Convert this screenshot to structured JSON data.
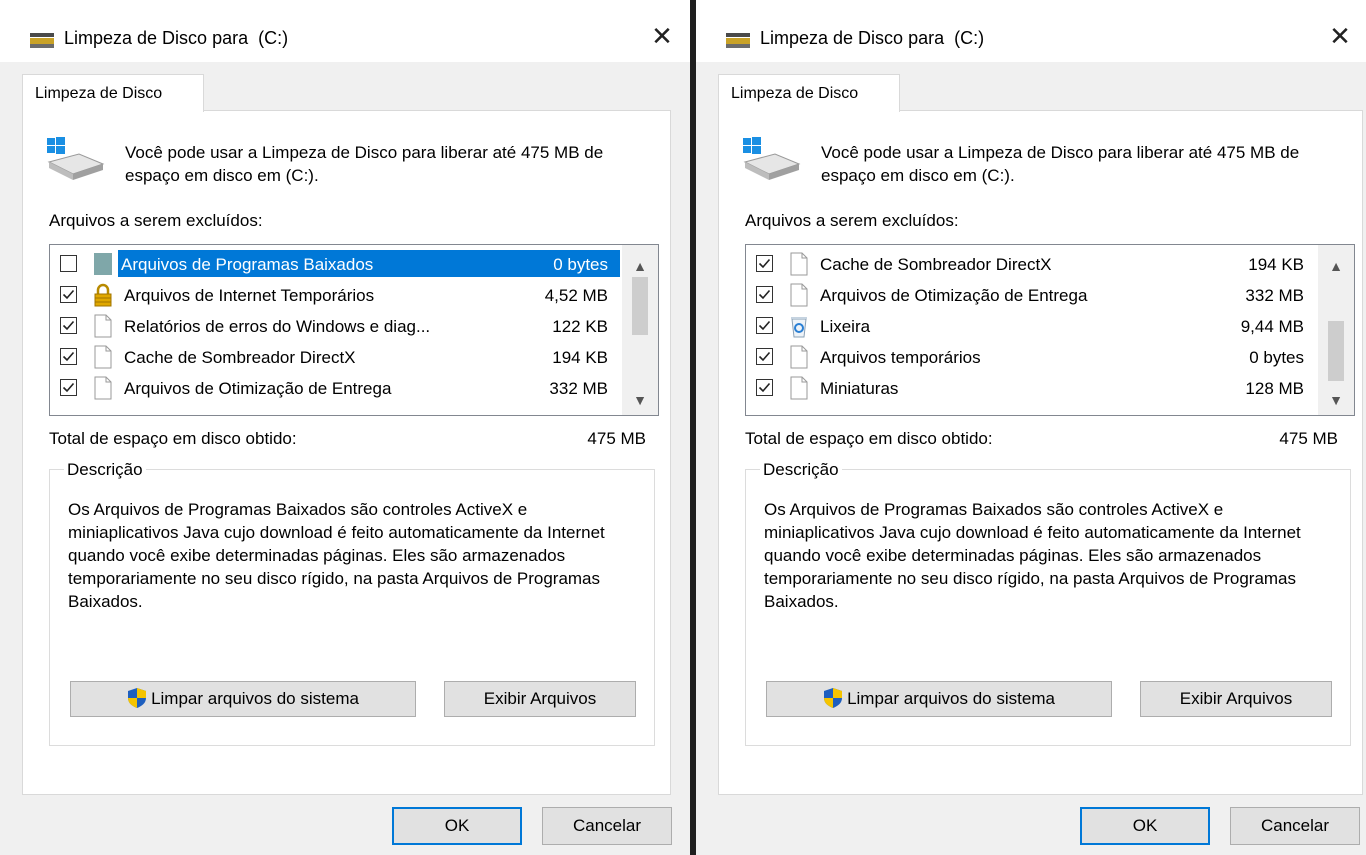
{
  "dialogs": [
    {
      "title": "Limpeza de Disco para  (C:)",
      "tab": "Limpeza de Disco",
      "intro": "Você pode usar a Limpeza de Disco para liberar até 475 MB de espaço em disco em  (C:).",
      "files_label": "Arquivos a serem excluídos:",
      "files": [
        {
          "name": "Arquivos de Programas Baixados",
          "size": "0 bytes",
          "checked": false,
          "selected": true,
          "icon": "folder-icon"
        },
        {
          "name": "Arquivos de Internet Temporários",
          "size": "4,52 MB",
          "checked": true,
          "selected": false,
          "icon": "lock-icon"
        },
        {
          "name": "Relatórios de erros do Windows e diag...",
          "size": "122 KB",
          "checked": true,
          "selected": false,
          "icon": "file-icon"
        },
        {
          "name": "Cache de Sombreador DirectX",
          "size": "194 KB",
          "checked": true,
          "selected": false,
          "icon": "file-icon"
        },
        {
          "name": "Arquivos de Otimização de Entrega",
          "size": "332 MB",
          "checked": true,
          "selected": false,
          "icon": "file-icon"
        }
      ],
      "scroll_position": "top",
      "total_label": "Total de espaço em disco obtido:",
      "total_value": "475 MB",
      "description_legend": "Descrição",
      "description": "Os Arquivos de Programas Baixados são controles ActiveX e miniaplicativos Java cujo download é feito automaticamente da Internet quando você exibe determinadas páginas. Eles são armazenados temporariamente no seu disco rígido, na pasta Arquivos de Programas Baixados.",
      "cleanup_button": "Limpar arquivos do sistema",
      "view_button": "Exibir Arquivos",
      "ok_button": "OK",
      "cancel_button": "Cancelar",
      "close_glyph": "✕"
    },
    {
      "title": "Limpeza de Disco para  (C:)",
      "tab": "Limpeza de Disco",
      "intro": "Você pode usar a Limpeza de Disco para liberar até 475 MB de espaço em disco em  (C:).",
      "files_label": "Arquivos a serem excluídos:",
      "files": [
        {
          "name": "Cache de Sombreador DirectX",
          "size": "194 KB",
          "checked": true,
          "selected": false,
          "icon": "file-icon"
        },
        {
          "name": "Arquivos de Otimização de Entrega",
          "size": "332 MB",
          "checked": true,
          "selected": false,
          "icon": "file-icon"
        },
        {
          "name": "Lixeira",
          "size": "9,44 MB",
          "checked": true,
          "selected": false,
          "icon": "recycle-bin-icon"
        },
        {
          "name": "Arquivos temporários",
          "size": "0 bytes",
          "checked": true,
          "selected": false,
          "icon": "file-icon"
        },
        {
          "name": "Miniaturas",
          "size": "128 MB",
          "checked": true,
          "selected": false,
          "icon": "file-icon"
        }
      ],
      "scroll_position": "bottom",
      "total_label": "Total de espaço em disco obtido:",
      "total_value": "475 MB",
      "description_legend": "Descrição",
      "description": "Os Arquivos de Programas Baixados são controles ActiveX e miniaplicativos Java cujo download é feito automaticamente da Internet quando você exibe determinadas páginas. Eles são armazenados temporariamente no seu disco rígido, na pasta Arquivos de Programas Baixados.",
      "cleanup_button": "Limpar arquivos do sistema",
      "view_button": "Exibir Arquivos",
      "ok_button": "OK",
      "cancel_button": "Cancelar",
      "close_glyph": "✕"
    }
  ],
  "colors": {
    "selection": "#0078d7",
    "dialog_bg": "#f0f0f0",
    "shield_blue": "#1e5fbf",
    "shield_yellow": "#f5c400"
  }
}
